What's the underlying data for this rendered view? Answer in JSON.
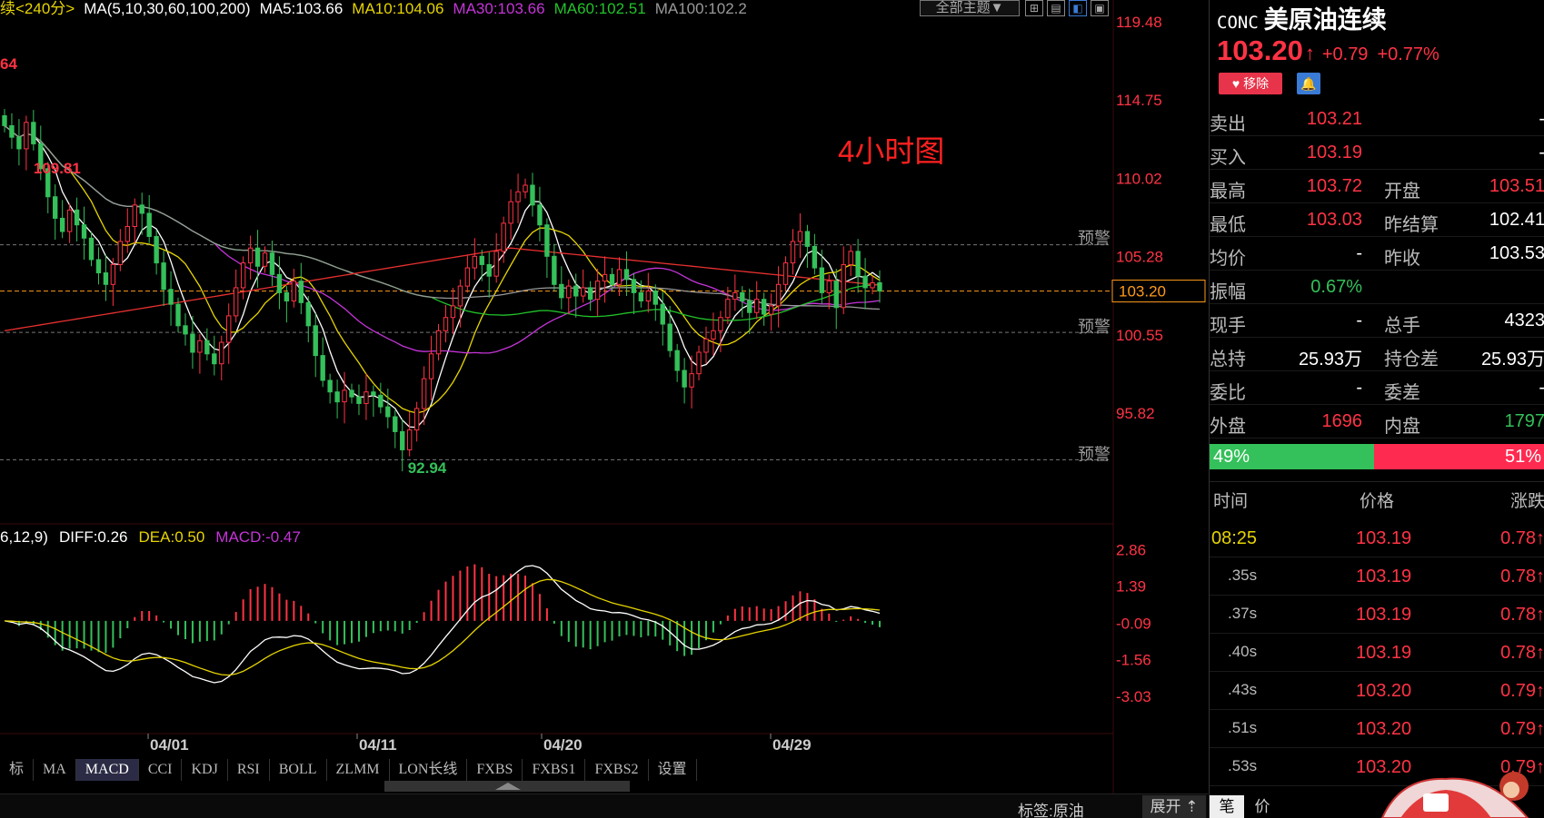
{
  "top_legend": {
    "period": "续<240分>",
    "ma_set": "MA(5,10,30,60,100,200)",
    "ma5": "MA5:103.66",
    "ma10": "MA10:104.06",
    "ma30": "MA30:103.66",
    "ma60": "MA60:102.51",
    "ma100": "MA100:102.2"
  },
  "theme_button": "全部主题▼",
  "annotation": "4小时图",
  "chart_labels": {
    "high_marker": "109.81",
    "low_marker": "92.94",
    "left_cut_marker": "64",
    "alert": "预警",
    "current_price_tag": "103.20"
  },
  "macd_legend": {
    "params": "6,12,9)",
    "diff": "DIFF:0.26",
    "dea": "DEA:0.50",
    "macd": "MACD:-0.47"
  },
  "tabs": [
    "标",
    "MA",
    "MACD",
    "CCI",
    "KDJ",
    "RSI",
    "BOLL",
    "ZLMM",
    "LON长线",
    "FXBS",
    "FXBS1",
    "FXBS2",
    "设置"
  ],
  "active_tab": "MACD",
  "status_bar": {
    "tag": "标签:原油",
    "expand": "展开"
  },
  "colors": {
    "up": "#ff3344",
    "down": "#34c05a",
    "ma5": "#ffffff",
    "ma10": "#e6d400",
    "ma30": "#c534d8",
    "ma60": "#22c22a",
    "ma100": "#999999",
    "ma200": "#e83030",
    "price_line": "#ff9a1a"
  },
  "quote": {
    "code": "CONC",
    "name": "美原油连续",
    "last": "103.20",
    "change": "+0.79",
    "change_pct": "+0.77%",
    "fav_label": "移除",
    "rows": [
      {
        "l": "卖出",
        "v": "103.21",
        "vc": "red",
        "l2": "",
        "v2": "-",
        "v2c": "white"
      },
      {
        "l": "买入",
        "v": "103.19",
        "vc": "red",
        "l2": "",
        "v2": "-",
        "v2c": "white"
      },
      {
        "l": "最高",
        "v": "103.72",
        "vc": "red",
        "l2": "开盘",
        "v2": "103.51",
        "v2c": "red"
      },
      {
        "l": "最低",
        "v": "103.03",
        "vc": "red",
        "l2": "昨结算",
        "v2": "102.41",
        "v2c": "white"
      },
      {
        "l": "均价",
        "v": "-",
        "vc": "white",
        "l2": "昨收",
        "v2": "103.53",
        "v2c": "white"
      },
      {
        "l": "振幅",
        "v": "0.67%",
        "vc": "green",
        "l2": "",
        "v2": "",
        "v2c": "white"
      },
      {
        "l": "现手",
        "v": "-",
        "vc": "white",
        "l2": "总手",
        "v2": "4323",
        "v2c": "white"
      },
      {
        "l": "总持",
        "v": "25.93万",
        "vc": "white",
        "l2": "持仓差",
        "v2": "25.93万",
        "v2c": "white"
      },
      {
        "l": "委比",
        "v": "-",
        "vc": "white",
        "l2": "委差",
        "v2": "-",
        "v2c": "white"
      },
      {
        "l": "外盘",
        "v": "1696",
        "vc": "red",
        "l2": "内盘",
        "v2": "1797",
        "v2c": "green"
      }
    ],
    "buy_pct": "49%",
    "sell_pct": "51%",
    "buy_ratio": 0.49
  },
  "ticks_header": {
    "time": "时间",
    "price": "价格",
    "change": "涨跌"
  },
  "ticks": [
    {
      "t": "08:25",
      "p": "103.19",
      "c": "0.78"
    },
    {
      "t": ".35s",
      "p": "103.19",
      "c": "0.78"
    },
    {
      "t": ".37s",
      "p": "103.19",
      "c": "0.78"
    },
    {
      "t": ".40s",
      "p": "103.19",
      "c": "0.78"
    },
    {
      "t": ".43s",
      "p": "103.20",
      "c": "0.79"
    },
    {
      "t": ".51s",
      "p": "103.20",
      "c": "0.79"
    },
    {
      "t": ".53s",
      "p": "103.20",
      "c": "0.79"
    }
  ],
  "panel_buttons": {
    "pen": "笔",
    "price": "价"
  },
  "chart_data": {
    "type": "candlestick",
    "price_axis": {
      "ticks": [
        "119.48",
        "114.75",
        "110.02",
        "105.28",
        "100.55",
        "95.82"
      ],
      "min": 91.1,
      "max": 119.48
    },
    "macd_axis": {
      "ticks": [
        "2.86",
        "1.39",
        "-0.09",
        "-1.56",
        "-3.03"
      ],
      "min": -3.5,
      "max": 3.2
    },
    "x_ticks": [
      "04/01",
      "04/11",
      "04/20",
      "04/29"
    ],
    "alert_levels": [
      106.0,
      100.7,
      93.0
    ],
    "current_price": 103.2,
    "close": [
      113.2,
      112.5,
      111.8,
      113.4,
      112.1,
      110.6,
      108.9,
      107.6,
      106.8,
      108.1,
      107.2,
      106.4,
      105.1,
      104.3,
      103.6,
      104.8,
      106.2,
      107.1,
      108.4,
      107.9,
      106.5,
      104.9,
      103.3,
      102.4,
      101.1,
      100.6,
      99.5,
      100.2,
      99.4,
      98.8,
      100.1,
      101.7,
      103.4,
      104.9,
      105.8,
      104.7,
      105.5,
      104.2,
      103.1,
      102.6,
      103.8,
      102.5,
      101.1,
      99.3,
      97.8,
      97.1,
      96.5,
      97.2,
      96.8,
      96.4,
      97.1,
      96.9,
      96.2,
      95.6,
      94.7,
      93.6,
      94.8,
      96.1,
      97.9,
      99.4,
      100.8,
      101.6,
      102.3,
      103.5,
      104.6,
      105.3,
      104.8,
      104.1,
      105.6,
      107.3,
      108.6,
      109.2,
      109.6,
      108.4,
      107.2,
      105.3,
      103.6,
      102.8,
      103.5,
      102.9,
      103.4,
      102.7,
      103.8,
      104.2,
      103.6,
      104.5,
      103.9,
      103.1,
      102.6,
      103.2,
      102.4,
      101.2,
      99.6,
      98.4,
      97.4,
      98.2,
      99.5,
      100.3,
      100.8,
      101.6,
      102.7,
      103.1,
      102.6,
      101.9,
      102.7,
      101.8,
      102.3,
      103.6,
      104.9,
      106.2,
      106.8,
      105.9,
      104.6,
      103.1,
      103.8,
      102.2,
      104.8,
      105.6,
      104.1,
      103.4,
      103.7,
      103.2
    ],
    "macd_legend": [
      "DIFF",
      "DEA",
      "MACD"
    ]
  }
}
